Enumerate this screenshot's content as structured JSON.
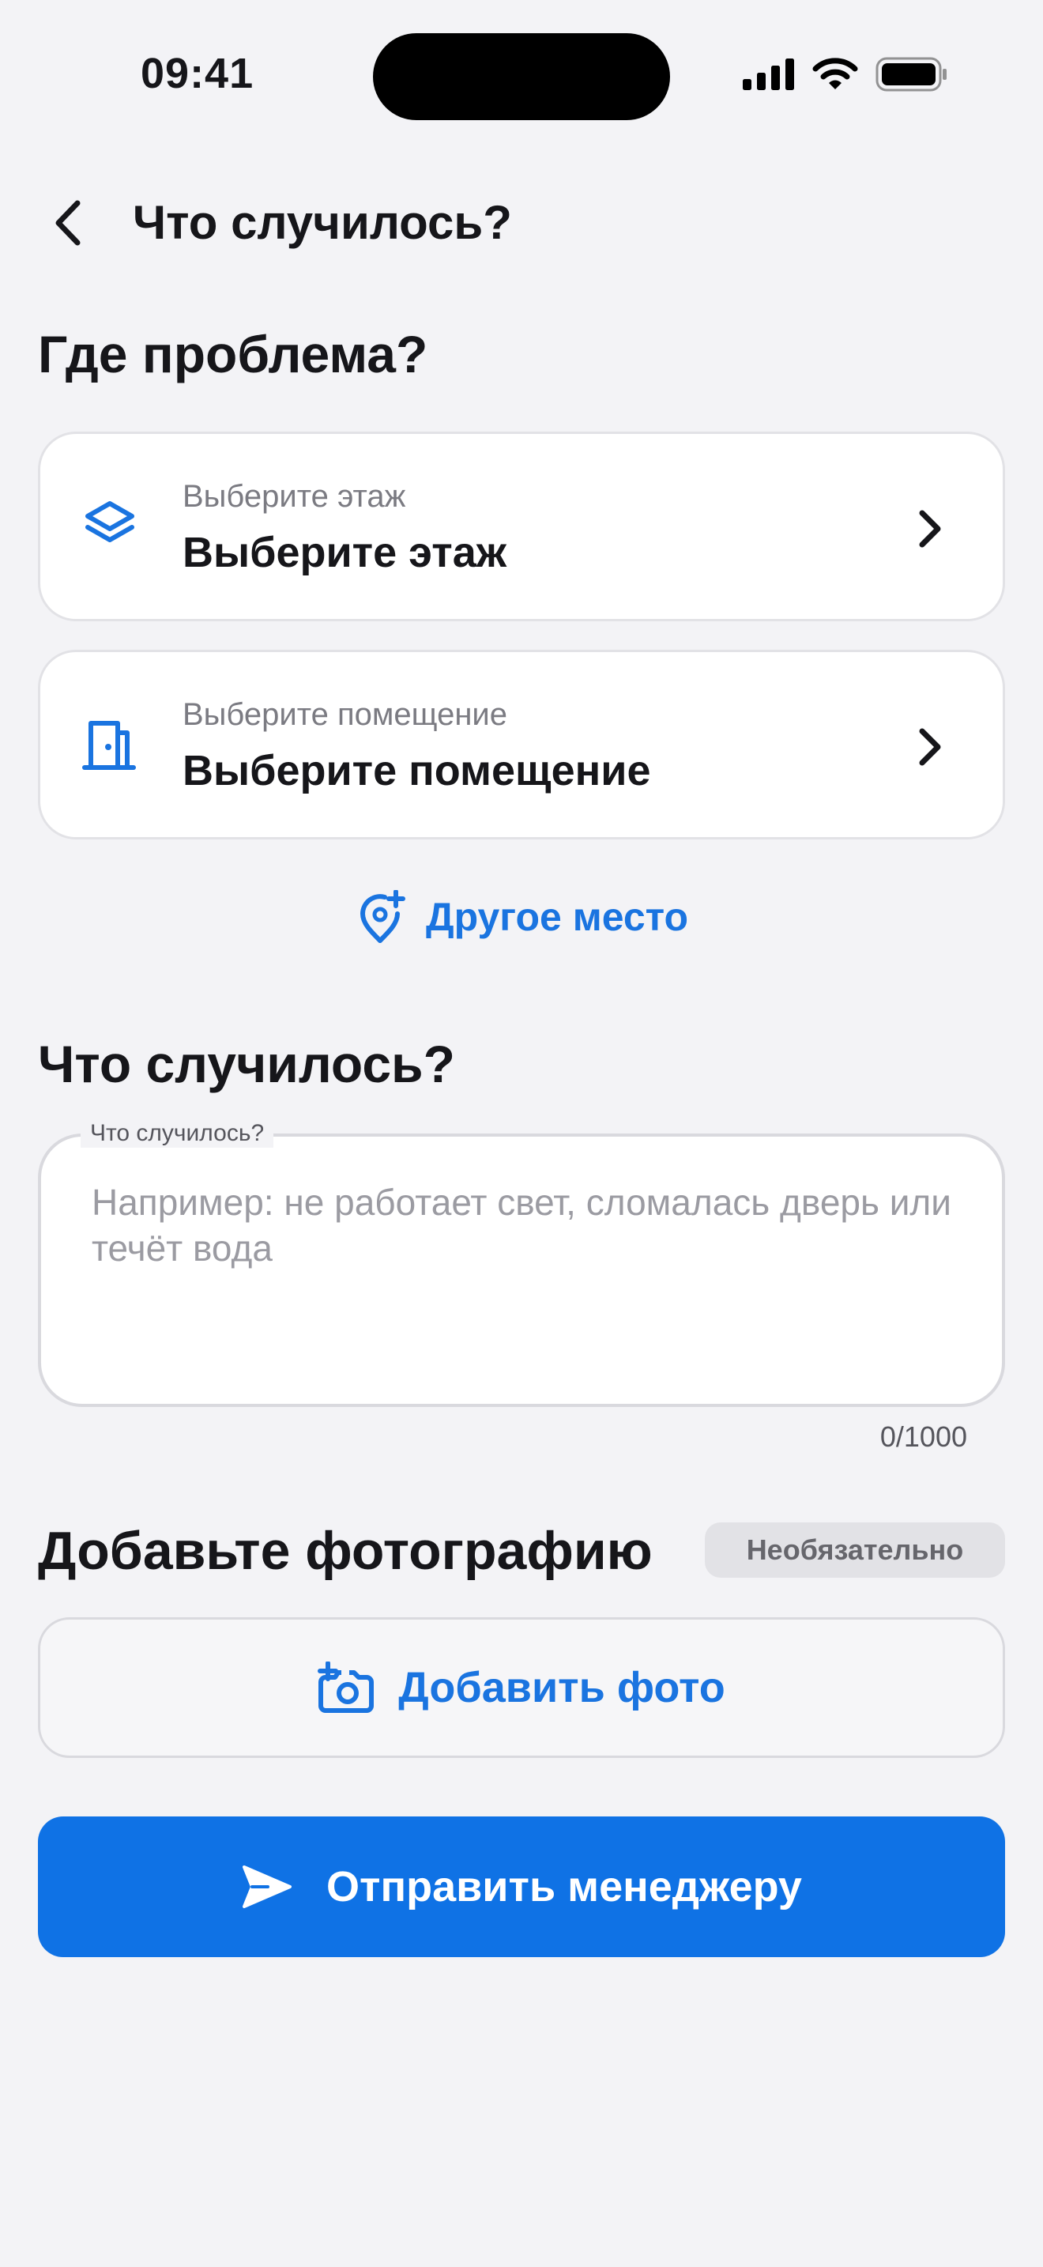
{
  "status_bar": {
    "time": "09:41"
  },
  "header": {
    "title": "Что случилось?"
  },
  "location": {
    "title": "Где проблема?",
    "floor": {
      "label": "Выберите этаж",
      "value": "Выберите этаж",
      "icon": "layers-icon"
    },
    "room": {
      "label": "Выберите помещение",
      "value": "Выберите помещение",
      "icon": "door-icon"
    },
    "other_place_label": "Другое место"
  },
  "description": {
    "title": "Что случилось?",
    "field_label": "Что случилось?",
    "placeholder": "Например: не работает свет, сломалась дверь или течёт вода",
    "counter": "0/1000"
  },
  "photo": {
    "title": "Добавьте фотографию",
    "badge": "Необязательно",
    "add_label": "Добавить фото"
  },
  "submit": {
    "label": "Отправить менеджеру"
  },
  "colors": {
    "accent": "#0f72e5",
    "link": "#1a74e0",
    "background": "#f3f3f6"
  }
}
